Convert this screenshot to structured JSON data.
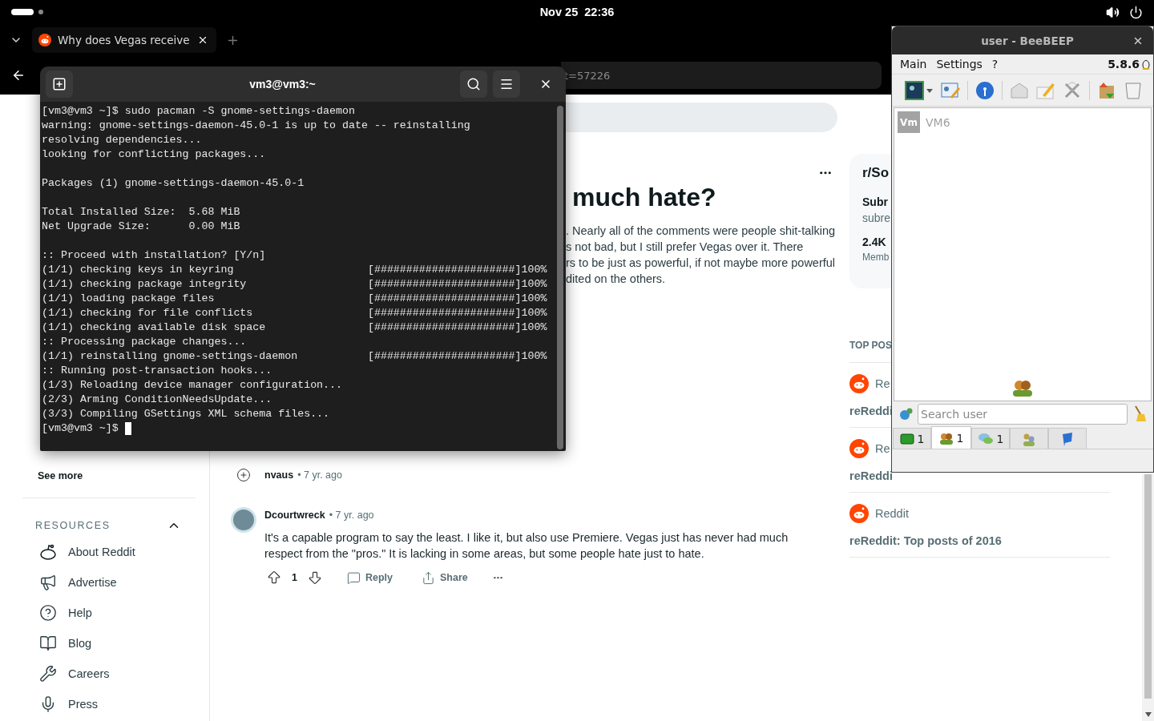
{
  "top_bar": {
    "clock": "Nov 25  22:36"
  },
  "browser": {
    "tabs": [
      {
        "title": "Why does Vegas receive",
        "selected": true
      }
    ],
    "url": "t=57226"
  },
  "reddit": {
    "sidebar": {
      "see_more": "See more",
      "resources": {
        "title": "RESOURCES",
        "expanded": true,
        "items": [
          {
            "label": "About Reddit"
          },
          {
            "label": "Advertise"
          },
          {
            "label": "Help"
          },
          {
            "label": "Blog"
          },
          {
            "label": "Careers"
          },
          {
            "label": "Press"
          }
        ]
      }
    },
    "post": {
      "title": "much hate?",
      "body_lines": [
        ". Nearly all of the comments were people shit-talking",
        "s not bad, but I still prefer Vegas over it. There",
        "rs to be just as powerful, if not maybe more powerful",
        "dited on the others."
      ]
    },
    "comments": [
      {
        "author": "nvaus",
        "age": "• 7 yr. ago",
        "collapsed": true
      },
      {
        "author": "Dcourtwreck",
        "age": "• 7 yr. ago",
        "collapsed": false,
        "text": "It's a capable program to say the least. I like it, but also use Premiere. Vegas just has never had much respect from the \"pros.\" It is lacking in some areas, but some people hate just to hate.",
        "votes": "1",
        "reply": "Reply",
        "share": "Share"
      }
    ],
    "community": {
      "name": "r/So",
      "label": "Subr",
      "sub": "subre",
      "members": "2.4K",
      "members_label": "Memb"
    },
    "top_posts": {
      "heading": "TOP POS",
      "items": [
        {
          "source": "Re",
          "title": "reReddi"
        },
        {
          "source": "Re",
          "title": "reReddi"
        },
        {
          "source": "Reddit",
          "title": "reReddit: Top posts of 2016"
        }
      ]
    }
  },
  "terminal": {
    "title": "vm3@vm3:~",
    "blocks": [
      [
        {
          "text": "[vm3@vm3 ~]$ sudo pacman -S gnome-settings-daemon"
        },
        {
          "text": "warning: gnome-settings-daemon-45.0-1 is up to date -- reinstalling"
        },
        {
          "text": "resolving dependencies..."
        },
        {
          "text": "looking for conflicting packages..."
        }
      ],
      [
        {
          "text": "Packages (1) gnome-settings-daemon-45.0-1"
        }
      ],
      [
        {
          "text": "Total Installed Size:  5.68 MiB"
        },
        {
          "text": "Net Upgrade Size:      0.00 MiB"
        }
      ],
      [
        {
          "text": ":: Proceed with installation? [Y/n]"
        },
        {
          "text": "(1/1) checking keys in keyring",
          "bar": "[######################]",
          "percent": "100%"
        },
        {
          "text": "(1/1) checking package integrity",
          "bar": "[######################]",
          "percent": "100%"
        },
        {
          "text": "(1/1) loading package files",
          "bar": "[######################]",
          "percent": "100%"
        },
        {
          "text": "(1/1) checking for file conflicts",
          "bar": "[######################]",
          "percent": "100%"
        },
        {
          "text": "(1/1) checking available disk space",
          "bar": "[######################]",
          "percent": "100%"
        },
        {
          "text": ":: Processing package changes..."
        },
        {
          "text": "(1/1) reinstalling gnome-settings-daemon",
          "bar": "[######################]",
          "percent": "100%"
        },
        {
          "text": ":: Running post-transaction hooks..."
        },
        {
          "text": "(1/3) Reloading device manager configuration..."
        },
        {
          "text": "(2/3) Arming ConditionNeedsUpdate..."
        },
        {
          "text": "(3/3) Compiling GSettings XML schema files..."
        },
        {
          "text": "[vm3@vm3 ~]$",
          "cursor": true
        }
      ]
    ]
  },
  "beebeep": {
    "title": "user - BeeBEEP",
    "menu": [
      "Main",
      "Settings",
      "?"
    ],
    "version": "5.8.6",
    "users": [
      {
        "initials": "Vm",
        "name": "VM6",
        "online": false
      }
    ],
    "search": {
      "placeholder": "Search user"
    },
    "tabs": [
      {
        "count": "1",
        "selected": false
      },
      {
        "count": "1",
        "selected": true
      },
      {
        "count": "1",
        "selected": false
      },
      {
        "selected": false
      },
      {
        "selected": false
      }
    ]
  }
}
